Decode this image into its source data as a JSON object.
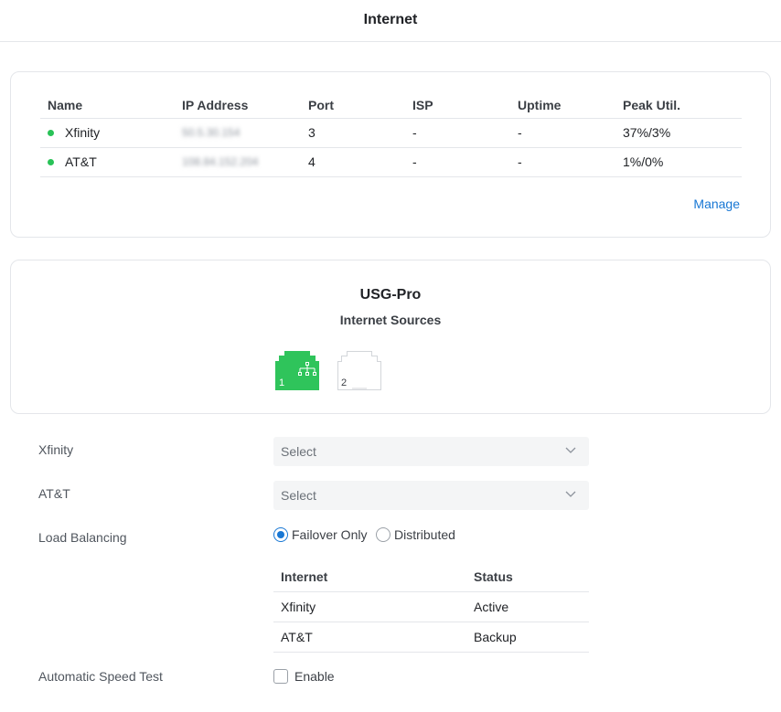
{
  "header": {
    "title": "Internet"
  },
  "wan_table": {
    "columns": [
      "Name",
      "IP Address",
      "Port",
      "ISP",
      "Uptime",
      "Peak Util."
    ],
    "rows": [
      {
        "status_color": "#29c257",
        "name": "Xfinity",
        "ip": "50.5.30.154",
        "port": "3",
        "isp": "-",
        "uptime": "-",
        "peak": "37%/3%"
      },
      {
        "status_color": "#29c257",
        "name": "AT&T",
        "ip": "108.84.152.204",
        "port": "4",
        "isp": "-",
        "uptime": "-",
        "peak": "1%/0%"
      }
    ],
    "manage_label": "Manage"
  },
  "device": {
    "name": "USG-Pro",
    "subtitle": "Internet Sources",
    "ports": [
      {
        "number": "1",
        "state": "connected",
        "color": "#2fc45b",
        "icon": "network-topology-icon"
      },
      {
        "number": "2",
        "state": "disconnected",
        "color": "#ffffff",
        "icon": "ethernet-port-icon"
      }
    ]
  },
  "settings": {
    "xfinity": {
      "label": "Xfinity",
      "select_value": "Select"
    },
    "att": {
      "label": "AT&T",
      "select_value": "Select"
    },
    "load_balancing": {
      "label": "Load Balancing",
      "options": [
        "Failover Only",
        "Distributed"
      ],
      "selected": "Failover Only"
    },
    "failover_table": {
      "columns": [
        "Internet",
        "Status"
      ],
      "rows": [
        {
          "internet": "Xfinity",
          "status": "Active"
        },
        {
          "internet": "AT&T",
          "status": "Backup"
        }
      ]
    },
    "speed_test": {
      "label": "Automatic Speed Test",
      "checkbox_label": "Enable",
      "checked": false
    }
  },
  "colors": {
    "accent": "#1877d4",
    "online": "#29c257",
    "border": "#e4e6ea"
  }
}
